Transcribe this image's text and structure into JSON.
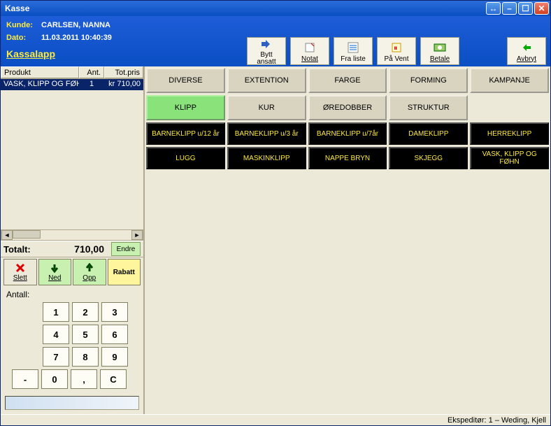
{
  "window": {
    "title": "Kasse"
  },
  "header": {
    "customer_label": "Kunde:",
    "customer_value": "CARLSEN, NANNA",
    "date_label": "Dato:",
    "date_value": "11.03.2011 10:40:39",
    "section": "Kassalapp"
  },
  "toolbar": {
    "bytt": "Bytt\nansatt",
    "bytt1": "Bytt",
    "bytt2": "ansatt",
    "notat": "Notat",
    "fraliste": "Fra liste",
    "pavent": "På Vent",
    "betale": "Betale",
    "avbryt": "Avbryt"
  },
  "products": {
    "head_product": "Produkt",
    "head_qty": "Ant.",
    "head_total": "Tot.pris",
    "rows": [
      {
        "name": "VASK, KLIPP OG FØHN",
        "qty": "1",
        "total": "kr 710,00"
      }
    ]
  },
  "total": {
    "label": "Totalt:",
    "value": "710,00",
    "endre": "Endre"
  },
  "actions": {
    "slett": "Slett",
    "ned": "Ned",
    "opp": "Opp",
    "rabatt": "Rabatt"
  },
  "qty": {
    "label": "Antall:"
  },
  "keypad": {
    "k1": "1",
    "k2": "2",
    "k3": "3",
    "k4": "4",
    "k5": "5",
    "k6": "6",
    "k7": "7",
    "k8": "8",
    "k9": "9",
    "minus": "-",
    "k0": "0",
    "comma": ",",
    "clear": "C"
  },
  "categories_row1": [
    "DIVERSE",
    "EXTENTION",
    "FARGE",
    "FORMING",
    "KAMPANJE"
  ],
  "categories_row2": [
    "KLIPP",
    "KUR",
    "ØREDOBBER",
    "STRUKTUR"
  ],
  "selected_category_index": 0,
  "services_row1": [
    "BARNEKLIPP u/12 år",
    "BARNEKLIPP u/3 år",
    "BARNEKLIPP u/7år",
    "DAMEKLIPP",
    "HERREKLIPP"
  ],
  "services_row2": [
    "LUGG",
    "MASKINKLIPP",
    "NAPPE BRYN",
    "SKJEGG",
    "VASK, KLIPP OG FØHN"
  ],
  "status": {
    "text": "Ekspeditør: 1 –  Weding, Kjell"
  }
}
